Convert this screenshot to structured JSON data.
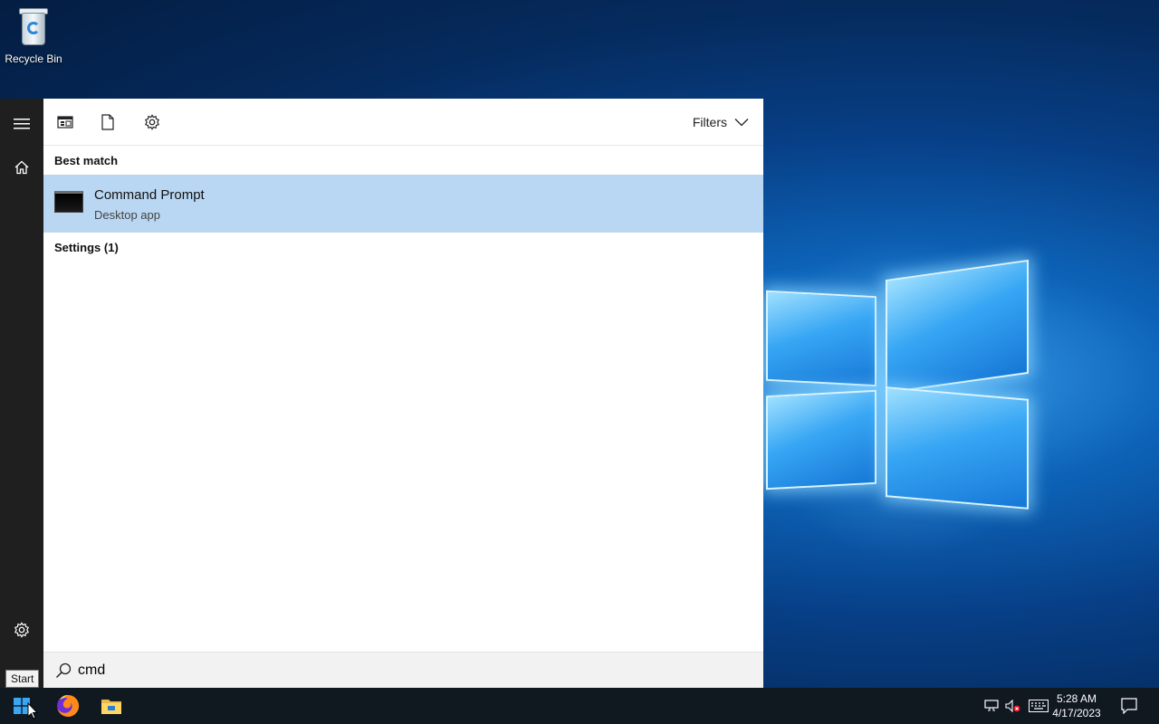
{
  "desktop": {
    "icons": [
      {
        "label": "Recycle Bin",
        "icon": "recycle-bin-icon"
      }
    ]
  },
  "start_menu": {
    "rail": {
      "menu_icon": "hamburger-icon",
      "home_icon": "home-icon",
      "settings_icon": "gear-icon"
    },
    "header": {
      "tab_icons": [
        "apps-icon",
        "documents-icon",
        "settings-icon"
      ],
      "filters_label": "Filters"
    },
    "sections": {
      "best_match": "Best match",
      "settings": "Settings (1)"
    },
    "best_result": {
      "title": "Command Prompt",
      "subtitle": "Desktop app",
      "icon": "cmd-icon"
    },
    "search": {
      "value": "cmd"
    }
  },
  "tooltip": {
    "text": "Start"
  },
  "taskbar": {
    "pinned": [
      "windows-start-icon",
      "firefox-icon",
      "file-explorer-icon"
    ],
    "tray": [
      "network-icon",
      "volume-muted-icon",
      "keyboard-icon",
      "notifications-icon"
    ],
    "clock": {
      "time": "5:28 AM",
      "date": "4/17/2023"
    }
  },
  "colors": {
    "selection": "#b9d7f2",
    "rail": "#1f1f1f",
    "taskbar": "#101820",
    "accent": "#0078d7"
  }
}
